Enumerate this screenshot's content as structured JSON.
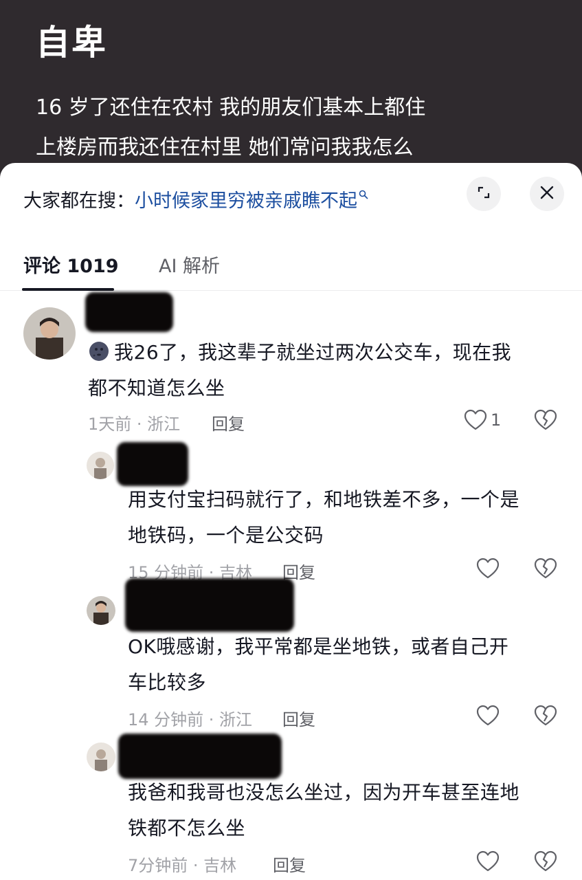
{
  "post": {
    "title": "自卑",
    "body_line1": "16 岁了还住在农村 我的朋友们基本上都住",
    "body_line2": "上楼房而我还住在村里 她们常问我我怎么"
  },
  "search": {
    "prefix": "大家都在搜：",
    "term": "小时候家里穷被亲戚瞧不起"
  },
  "tabs": {
    "comments": "评论 1019",
    "ai": "AI 解析"
  },
  "comments": [
    {
      "line1": "我26了，我这辈子就坐过两次公交车，现在我",
      "line2": "都不知道怎么坐",
      "time": "1天前 · 浙江",
      "reply": "回复",
      "likes": "1"
    },
    {
      "line1": "用支付宝扫码就行了，和地铁差不多，一个是",
      "line2": "地铁码，一个是公交码",
      "time": "15 分钟前 · 吉林",
      "reply": "回复"
    },
    {
      "line1": "OK哦感谢，我平常都是坐地铁，或者自己开",
      "line2": "车比较多",
      "time": "14 分钟前 · 浙江",
      "reply": "回复"
    },
    {
      "line1": "我爸和我哥也没怎么坐过，因为开车甚至连地",
      "line2": "铁都不怎么坐",
      "time": "7分钟前 · 吉林",
      "reply": "回复"
    }
  ],
  "icons": {
    "expand": "expand-icon",
    "close": "close-icon",
    "like": "heart-outline-icon",
    "dislike": "broken-heart-icon",
    "search": "search-icon"
  },
  "colors": {
    "link": "#1d4fa0",
    "meta": "#a1a2a7",
    "text": "#161823",
    "backdrop": "#2f2a2e"
  }
}
